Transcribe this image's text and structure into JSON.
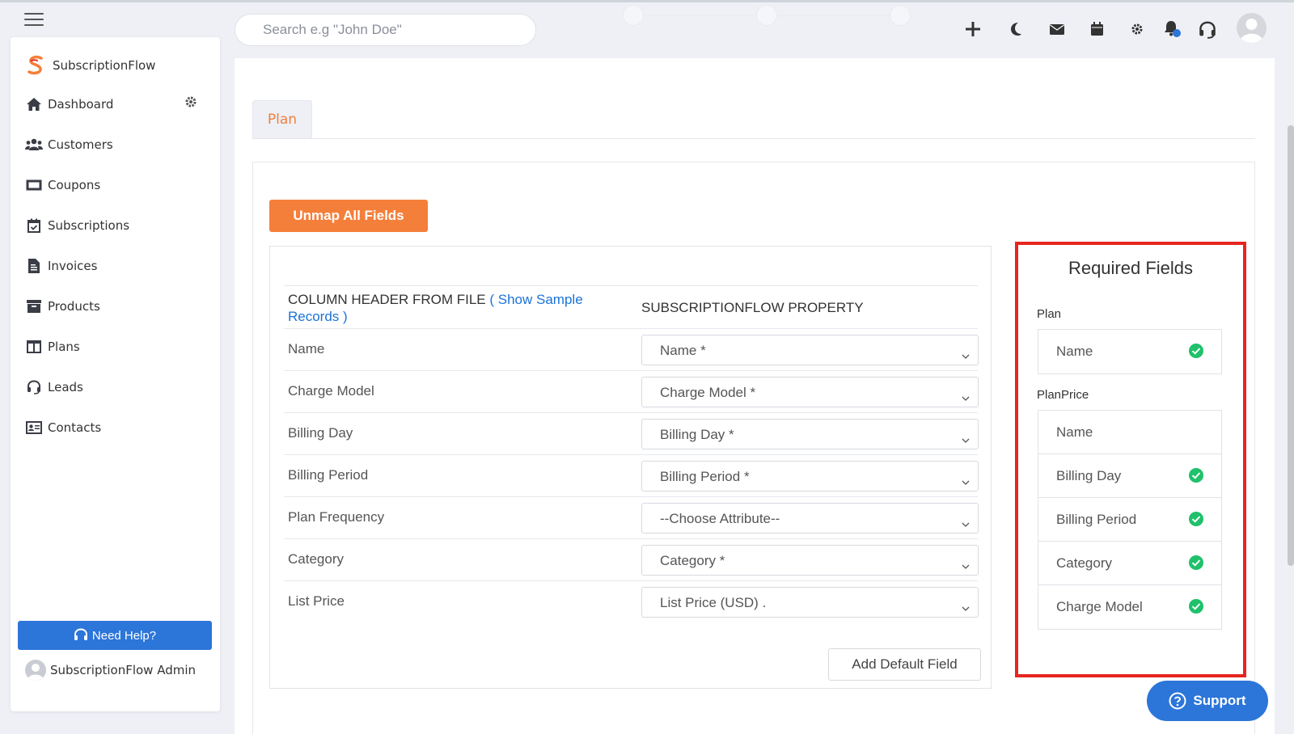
{
  "sidebar": {
    "brand": "SubscriptionFlow",
    "items": [
      {
        "label": "Dashboard",
        "icon": "home-icon"
      },
      {
        "label": "Customers",
        "icon": "users-icon"
      },
      {
        "label": "Coupons",
        "icon": "ticket-icon"
      },
      {
        "label": "Subscriptions",
        "icon": "calendar-check-icon"
      },
      {
        "label": "Invoices",
        "icon": "invoice-icon"
      },
      {
        "label": "Products",
        "icon": "archive-icon"
      },
      {
        "label": "Plans",
        "icon": "columns-icon"
      },
      {
        "label": "Leads",
        "icon": "headset-icon"
      },
      {
        "label": "Contacts",
        "icon": "id-card-icon"
      }
    ],
    "help_label": "Need Help?",
    "admin_label": "SubscriptionFlow Admin"
  },
  "header": {
    "search_placeholder": "Search e.g \"John Doe\""
  },
  "main": {
    "tab_label": "Plan",
    "unmap_label": "Unmap All Fields",
    "col1_header": "COLUMN HEADER FROM FILE",
    "col1_link": "( Show Sample Records )",
    "col2_header": "SUBSCRIPTIONFLOW PROPERTY",
    "rows": [
      {
        "label": "Name",
        "value": "Name *"
      },
      {
        "label": "Charge Model",
        "value": "Charge Model *"
      },
      {
        "label": "Billing Day",
        "value": "Billing Day *"
      },
      {
        "label": "Billing Period",
        "value": "Billing Period *"
      },
      {
        "label": "Plan Frequency",
        "value": "--Choose Attribute--"
      },
      {
        "label": "Category",
        "value": "Category *"
      },
      {
        "label": "List Price",
        "value": "List Price (USD) ."
      }
    ],
    "add_default_label": "Add Default Field"
  },
  "required": {
    "title": "Required Fields",
    "groups": [
      {
        "label": "Plan",
        "items": [
          {
            "label": "Name",
            "checked": true
          }
        ]
      },
      {
        "label": "PlanPrice",
        "items": [
          {
            "label": "Name",
            "checked": false
          },
          {
            "label": "Billing Day",
            "checked": true
          },
          {
            "label": "Billing Period",
            "checked": true
          },
          {
            "label": "Category",
            "checked": true
          },
          {
            "label": "Charge Model",
            "checked": true
          }
        ]
      }
    ]
  },
  "support_label": "Support",
  "colors": {
    "accent_orange": "#f47f3b",
    "primary_blue": "#2c75d9",
    "highlight_red": "#e6261f",
    "check_green": "#1fc16b"
  }
}
